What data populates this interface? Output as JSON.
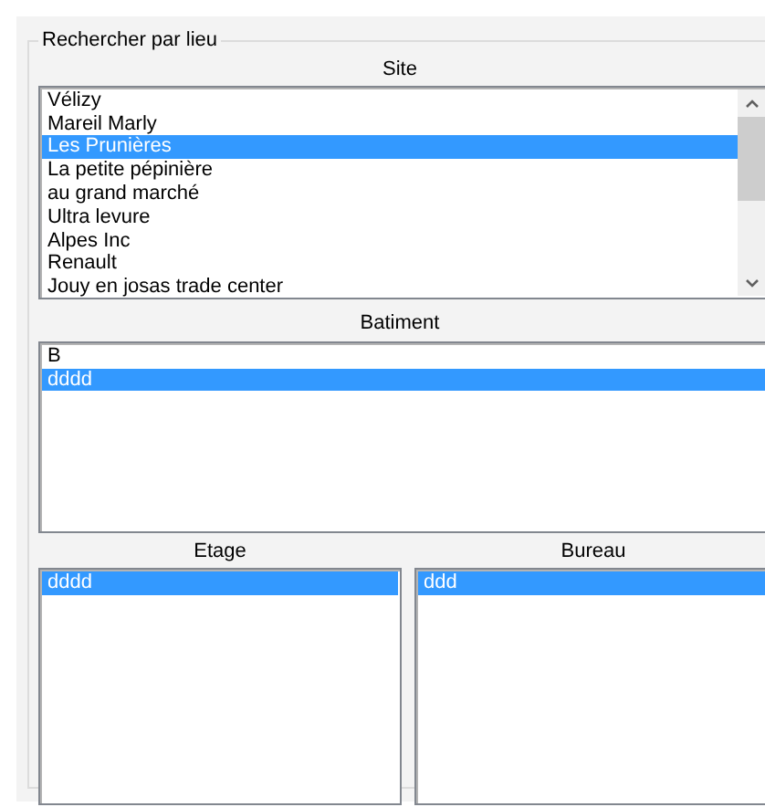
{
  "group_title": "Rechercher par lieu",
  "site": {
    "label": "Site",
    "items": [
      {
        "text": "Vélizy",
        "selected": false
      },
      {
        "text": "Mareil Marly",
        "selected": false
      },
      {
        "text": "Les Prunières",
        "selected": true
      },
      {
        "text": "La petite pépinière",
        "selected": false
      },
      {
        "text": "au grand marché",
        "selected": false
      },
      {
        "text": "Ultra levure",
        "selected": false
      },
      {
        "text": "Alpes Inc",
        "selected": false
      },
      {
        "text": "Renault",
        "selected": false
      },
      {
        "text": "Jouy en josas trade center",
        "selected": false
      }
    ]
  },
  "batiment": {
    "label": "Batiment",
    "items": [
      {
        "text": "B",
        "selected": false
      },
      {
        "text": "dddd",
        "selected": true
      }
    ]
  },
  "etage": {
    "label": "Etage",
    "items": [
      {
        "text": "dddd",
        "selected": true
      }
    ]
  },
  "bureau": {
    "label": "Bureau",
    "items": [
      {
        "text": "ddd",
        "selected": true
      }
    ]
  }
}
